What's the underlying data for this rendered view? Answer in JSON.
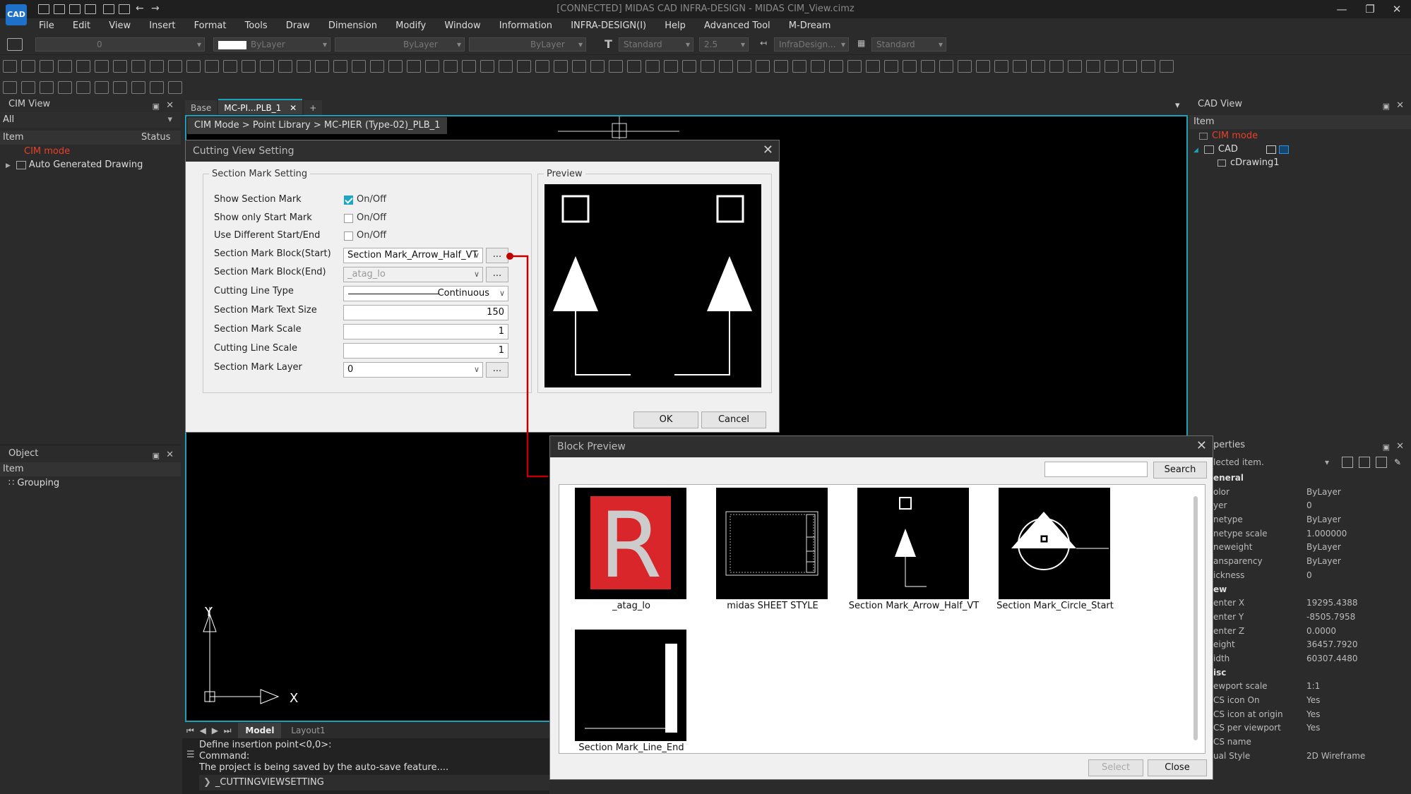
{
  "app": {
    "title": "[CONNECTED] MIDAS CAD INFRA-DESIGN - MIDAS CIM_View.cimz",
    "logo": "CAD",
    "window_controls": [
      "—",
      "❐",
      "✕"
    ]
  },
  "menu": [
    "File",
    "Edit",
    "View",
    "Insert",
    "Format",
    "Tools",
    "Draw",
    "Dimension",
    "Modify",
    "Window",
    "Information",
    "INFRA-DESIGN(I)",
    "Help",
    "Advanced Tool",
    "M-Dream"
  ],
  "toolbar": {
    "layer_value": "0",
    "color_value": "ByLayer",
    "linetype_value": "ByLayer",
    "lineweight_value": "ByLayer",
    "text_style": "Standard",
    "text_height": "2.5",
    "dim_style": "InfraDesign...",
    "table_style": "Standard"
  },
  "cim_view": {
    "title": "CIM View",
    "filter": "All",
    "col_item": "Item",
    "col_status": "Status",
    "rows": [
      "CIM mode",
      "Auto Generated Drawing"
    ]
  },
  "object_panel": {
    "title": "Object",
    "col_item": "Item",
    "rows": [
      "Grouping"
    ]
  },
  "doc_tabs": [
    "Base",
    "MC-PI...PLB_1",
    "+"
  ],
  "breadcrumb": "CIM Mode > Point Library > MC-PIER (Type-02)_PLB_1",
  "cad_view": {
    "title": "CAD View",
    "col_item": "Item",
    "rows": [
      "CIM mode",
      "CAD",
      "cDrawing1"
    ]
  },
  "cutting_dialog": {
    "title": "Cutting View Setting",
    "group_title": "Section Mark Setting",
    "preview_title": "Preview",
    "fields": {
      "show_section_mark": {
        "label": "Show Section Mark",
        "check_label": "On/Off",
        "checked": true
      },
      "show_only_start": {
        "label": "Show only Start Mark",
        "check_label": "On/Off",
        "checked": false
      },
      "use_different": {
        "label": "Use Different Start/End",
        "check_label": "On/Off",
        "checked": false
      },
      "block_start": {
        "label": "Section Mark Block(Start)",
        "value": "Section Mark_Arrow_Half_VT"
      },
      "block_end": {
        "label": "Section Mark Block(End)",
        "value": "_atag_lo"
      },
      "line_type": {
        "label": "Cutting Line Type",
        "value": "Continuous"
      },
      "text_size": {
        "label": "Section Mark Text Size",
        "value": "150"
      },
      "mark_scale": {
        "label": "Section Mark Scale",
        "value": "1"
      },
      "line_scale": {
        "label": "Cutting Line Scale",
        "value": "1"
      },
      "mark_layer": {
        "label": "Section Mark Layer",
        "value": "0"
      }
    },
    "dots": "...",
    "ok": "OK",
    "cancel": "Cancel"
  },
  "block_preview": {
    "title": "Block Preview",
    "search_value": "",
    "search_button": "Search",
    "items": [
      "_atag_lo",
      "midas SHEET STYLE",
      "Section Mark_Arrow_Half_VT",
      "Section Mark_Circle_Start",
      "Section Mark_Line_End"
    ],
    "select": "Select",
    "close": "Close"
  },
  "properties": {
    "title": "perties",
    "selector": "lected item.",
    "sections": [
      {
        "name": "eneral",
        "rows": [
          [
            "olor",
            "ByLayer"
          ],
          [
            "yer",
            "0"
          ],
          [
            "netype",
            "ByLayer"
          ],
          [
            "netype scale",
            "1.000000"
          ],
          [
            "neweight",
            "ByLayer"
          ],
          [
            "ansparency",
            "ByLayer"
          ],
          [
            "ickness",
            "0"
          ]
        ]
      },
      {
        "name": "ew",
        "rows": [
          [
            "enter X",
            "19295.4388"
          ],
          [
            "enter Y",
            "-8505.7958"
          ],
          [
            "enter Z",
            "0.0000"
          ],
          [
            "eight",
            "36457.7920"
          ],
          [
            "idth",
            "60307.4480"
          ]
        ]
      },
      {
        "name": "isc",
        "rows": [
          [
            "ewport scale",
            "1:1"
          ],
          [
            "CS icon On",
            "Yes"
          ],
          [
            "CS icon at origin",
            "Yes"
          ],
          [
            "CS per viewport",
            "Yes"
          ],
          [
            "CS name",
            ""
          ],
          [
            "ual Style",
            "2D Wireframe"
          ]
        ]
      }
    ]
  },
  "layout_tabs": [
    "Model",
    "Layout1"
  ],
  "command": {
    "lines": [
      "Define insertion point<0,0>:",
      "Command:",
      "The project is being saved by the auto-save feature...."
    ],
    "prompt": "_CUTTINGVIEWSETTING"
  },
  "ucs": {
    "x": "X",
    "y": "Y"
  },
  "colors": {
    "accent": "#1aa3b8",
    "cim_red": "#e8402a",
    "arrow_red": "#c00000"
  }
}
